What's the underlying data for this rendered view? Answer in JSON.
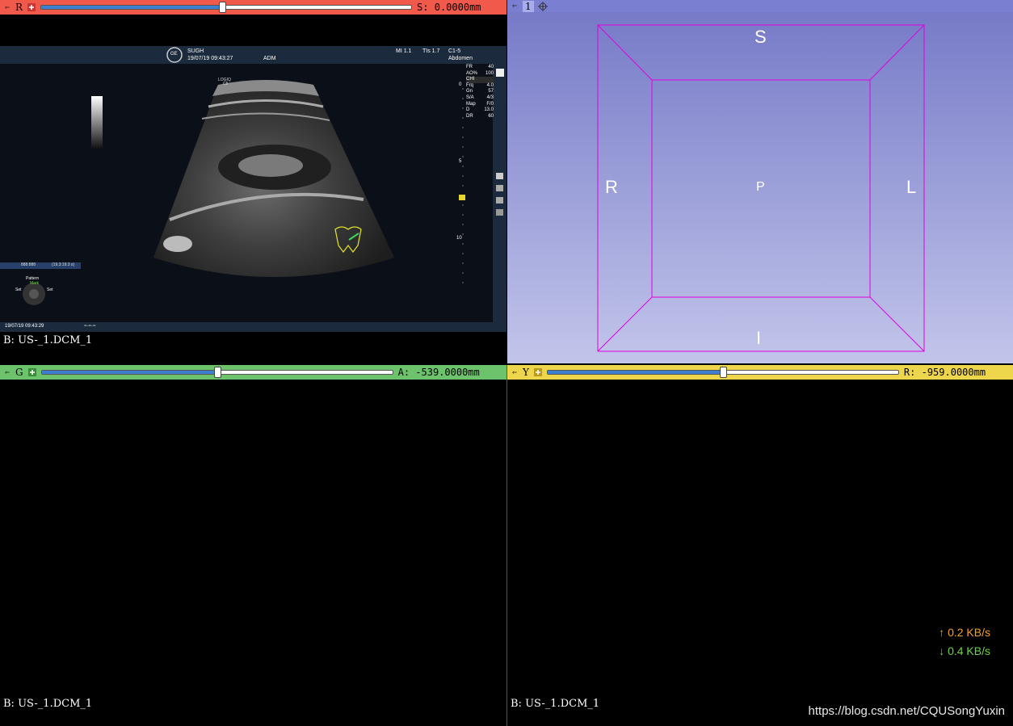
{
  "views": {
    "red": {
      "label": "R",
      "offset": "S: 0.0000mm",
      "volume_label": "B: US-_1.DCM_1",
      "color": "#f15a4b",
      "slider_fraction": 0.49
    },
    "threed": {
      "label": "1",
      "color": "#7b7fd1",
      "orientation": {
        "superior": "S",
        "inferior": "I",
        "right": "R",
        "left": "L",
        "posterior": "P"
      }
    },
    "green": {
      "label": "G",
      "offset": "A: -539.0000mm",
      "volume_label": "B: US-_1.DCM_1",
      "color": "#6dc36b",
      "slider_fraction": 0.5
    },
    "yellow": {
      "label": "Y",
      "offset": "R: -959.0000mm",
      "volume_label": "B: US-_1.DCM_1",
      "color": "#edd54c",
      "slider_fraction": 0.5
    }
  },
  "ultrasound": {
    "hospital": "SUGH",
    "datetime": "19/07/19 09:43:27",
    "operator": "ADM",
    "mi": "MI 1.1",
    "tis": "TIs 1.7",
    "probe": "C1-5",
    "preset": "Abdomen",
    "logo": "GE",
    "device": "LOGIQ",
    "device_sub": "C5",
    "params": [
      {
        "k": "FR",
        "v": "40"
      },
      {
        "k": "AO%",
        "v": "100"
      },
      {
        "k": "CHI",
        "v": ""
      },
      {
        "k": "Frq",
        "v": "4.0"
      },
      {
        "k": "Gn",
        "v": "57"
      },
      {
        "k": "S/A",
        "v": "4/3"
      },
      {
        "k": "Map",
        "v": "F/0"
      },
      {
        "k": "D",
        "v": "13.0"
      },
      {
        "k": "DR",
        "v": "60"
      }
    ],
    "depth_marks": [
      "0",
      "5",
      "10"
    ],
    "footer_datetime": "19/07/19 09:43:29",
    "footer_extra": "=-=-=",
    "counter": "888:888",
    "counter_right": "(19.3:19.3 s)",
    "pattern_label": "Pattern",
    "mark_label": "Mark",
    "set_left": "Set",
    "set_right": "Set"
  },
  "network": {
    "up": "↑ 0.2 KB/s",
    "down": "↓ 0.4 KB/s",
    "up_color": "#f0a030",
    "down_color": "#6cd34a"
  },
  "watermark": "https://blog.csdn.net/CQUSongYuxin"
}
